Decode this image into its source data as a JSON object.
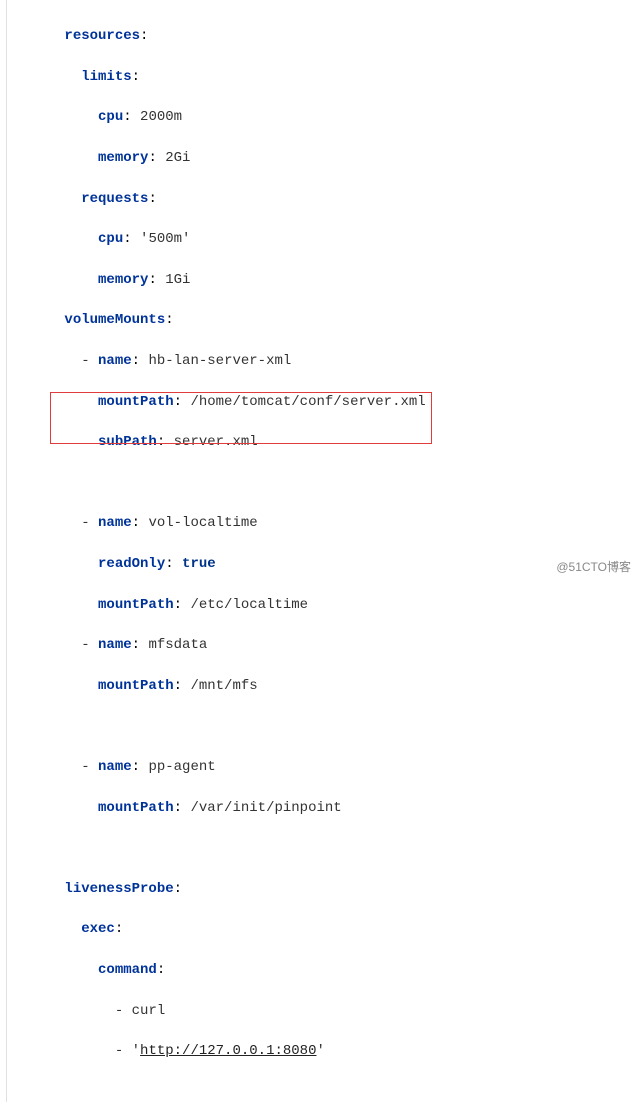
{
  "yaml": {
    "resources": {
      "key": "resources",
      "limits": {
        "key": "limits",
        "cpu_k": "cpu",
        "cpu_v": "2000m",
        "mem_k": "memory",
        "mem_v": "2Gi"
      },
      "requests": {
        "key": "requests",
        "cpu_k": "cpu",
        "cpu_v": "'500m'",
        "mem_k": "memory",
        "mem_v": "1Gi"
      }
    },
    "volumeMounts": {
      "key": "volumeMounts",
      "items": [
        {
          "name_k": "name",
          "name_v": "hb-lan-server-xml",
          "mount_k": "mountPath",
          "mount_v": "/home/tomcat/conf/server.xml",
          "sub_k": "subPath",
          "sub_v": "server.xml"
        },
        {
          "name_k": "name",
          "name_v": "vol-localtime",
          "ro_k": "readOnly",
          "ro_v": "true",
          "mount_k": "mountPath",
          "mount_v": "/etc/localtime"
        },
        {
          "name_k": "name",
          "name_v": "mfsdata",
          "mount_k": "mountPath",
          "mount_v": "/mnt/mfs"
        },
        {
          "name_k": "name",
          "name_v": "pp-agent",
          "mount_k": "mountPath",
          "mount_v": "/var/init/pinpoint"
        }
      ]
    },
    "livenessProbe": {
      "key": "livenessProbe",
      "exec_k": "exec",
      "command_k": "command",
      "items": [
        "curl",
        "http://127.0.0.1:8080"
      ]
    }
  },
  "watermark": "@51CTO博客"
}
